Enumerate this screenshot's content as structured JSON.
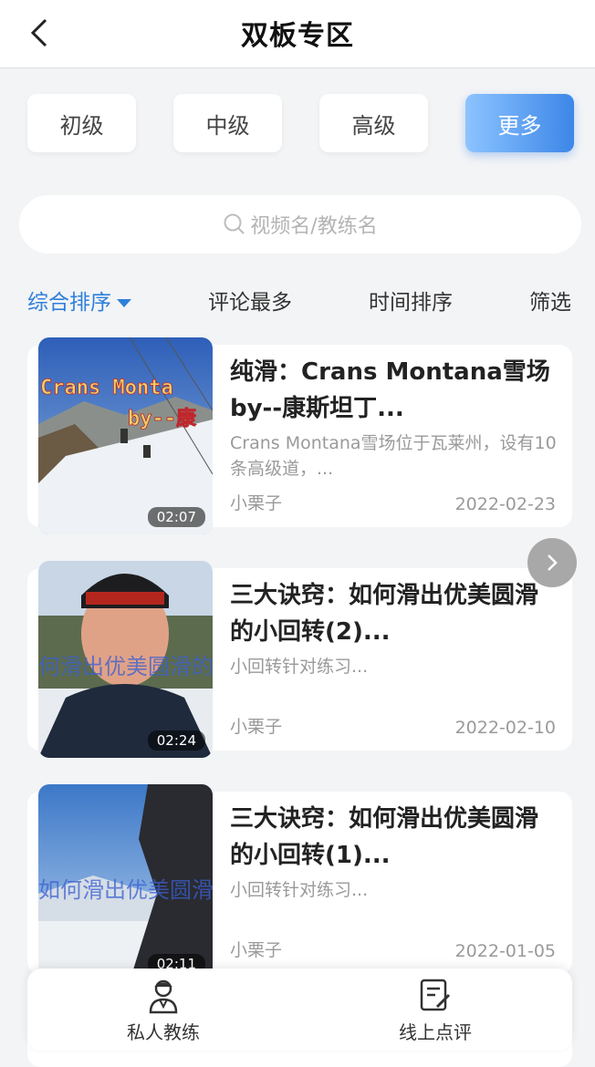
{
  "header": {
    "title": "双板专区"
  },
  "levels": [
    {
      "label": "初级",
      "active": false
    },
    {
      "label": "中级",
      "active": false
    },
    {
      "label": "高级",
      "active": false
    },
    {
      "label": "更多",
      "active": true
    }
  ],
  "search": {
    "placeholder": "视频名/教练名"
  },
  "sort": {
    "items": [
      "综合排序",
      "评论最多",
      "时间排序",
      "筛选"
    ],
    "active_index": 0
  },
  "videos": [
    {
      "title": "纯滑：Crans Montana雪场by--康斯坦丁...",
      "description": "Crans Montana雪场位于瓦莱州，设有10条高级道，...",
      "author": "小栗子",
      "date": "2022-02-23",
      "duration": "02:07",
      "thumbnail_overlay": "Crans Monta by--康"
    },
    {
      "title": "三大诀窍：如何滑出优美圆滑的小回转(2)...",
      "description": "小回转针对练习...",
      "author": "小栗子",
      "date": "2022-02-10",
      "duration": "02:24",
      "thumbnail_overlay": "何滑出优美圆滑的"
    },
    {
      "title": "三大诀窍：如何滑出优美圆滑的小回转(1)...",
      "description": "小回转针对练习...",
      "author": "小栗子",
      "date": "2022-01-05",
      "duration": "02:11",
      "thumbnail_overlay": "如何滑出优美圆滑"
    }
  ],
  "bottom_nav": {
    "items": [
      "私人教练",
      "线上点评"
    ]
  },
  "colors": {
    "accent": "#2f7fd9",
    "active_button": "#3d86e8",
    "background": "#f3f4f6"
  }
}
